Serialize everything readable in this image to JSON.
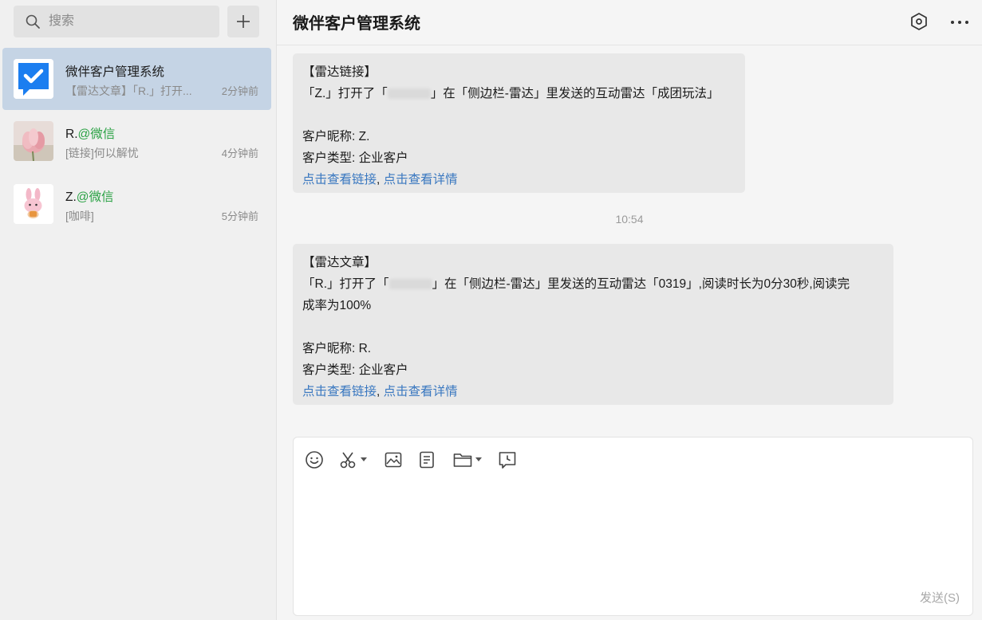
{
  "sidebar": {
    "search": {
      "placeholder": "搜索"
    },
    "conversations": [
      {
        "name": "微伴客户管理系统",
        "name_suffix": "",
        "preview": "【雷达文章】「R.」打开...",
        "time": "2分钟前",
        "active": true,
        "avatar_icon": "check-message-icon"
      },
      {
        "name": "R.",
        "name_suffix": "@微信",
        "preview": "[链接]何以解忧",
        "time": "4分钟前",
        "active": false,
        "avatar_icon": "lotus-avatar"
      },
      {
        "name": "Z.",
        "name_suffix": "@微信",
        "preview": "[咖啡]",
        "time": "5分钟前",
        "active": false,
        "avatar_icon": "bunny-avatar"
      }
    ]
  },
  "chat": {
    "title": "微伴客户管理系统",
    "messages": [
      {
        "heading": "【雷达链接】",
        "body_pre": "「Z.」打开了「",
        "body_post": "」在「侧边栏-雷达」里发送的互动雷达「成团玩法」",
        "body_cont": "",
        "nickname": "客户昵称: Z.",
        "type": "客户类型: 企业客户",
        "link1": "点击查看链接",
        "sep": ", ",
        "link2": "点击查看详情"
      },
      {
        "heading": "【雷达文章】",
        "body_pre": "「R.」打开了「",
        "body_post": "」在「侧边栏-雷达」里发送的互动雷达「0319」,阅读时长为0分30秒,阅读完",
        "body_cont": "成率为100%",
        "nickname": "客户昵称: R.",
        "type": "客户类型: 企业客户",
        "link1": "点击查看链接",
        "sep": ", ",
        "link2": "点击查看详情"
      }
    ],
    "timestamp": "10:54",
    "composer": {
      "tools": [
        "emoji-icon",
        "scissors-icon",
        "image-icon",
        "document-icon",
        "folder-icon",
        "schedule-icon"
      ],
      "send_label": "发送(S)"
    }
  },
  "colors": {
    "sidebar_bg": "#f0f0f0",
    "active_item_bg": "#c5d4e5",
    "bubble_bg": "#e8e8e8",
    "link": "#3a78c0",
    "wechat_green": "#2ba245",
    "brand_blue": "#1b7ef0"
  }
}
